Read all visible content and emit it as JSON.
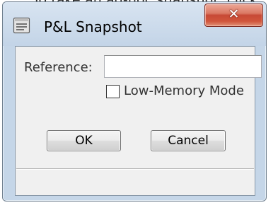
{
  "background_text": "To take an ad-hoc snapshot, click",
  "window": {
    "title": "P&L Snapshot",
    "close_icon": "close-x-icon",
    "app_icon": "document-icon"
  },
  "form": {
    "reference_label": "Reference:",
    "reference_value": "",
    "low_memory_label": "Low-Memory Mode",
    "low_memory_checked": false
  },
  "buttons": {
    "ok_label": "OK",
    "cancel_label": "Cancel"
  },
  "colors": {
    "close_button": "#c74935",
    "frame": "#c5d6e8"
  }
}
